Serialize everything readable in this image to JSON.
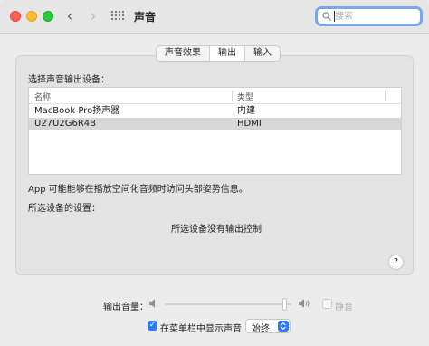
{
  "window": {
    "title": "声音"
  },
  "search": {
    "placeholder": "搜索"
  },
  "tabs": [
    {
      "label": "声音效果"
    },
    {
      "label": "输出",
      "active": true
    },
    {
      "label": "输入"
    }
  ],
  "output": {
    "select_label": "选择声音输出设备：",
    "columns": {
      "name": "名称",
      "type": "类型"
    },
    "devices": [
      {
        "name": "MacBook Pro扬声器",
        "type": "内建"
      },
      {
        "name": "U27U2G6R4B",
        "type": "HDMI",
        "selected": true
      }
    ],
    "note": "App 可能能够在播放空间化音频时访问头部姿势信息。",
    "settings_label": "所选设备的设置：",
    "no_control": "所选设备没有输出控制",
    "help": "?"
  },
  "volume": {
    "label": "输出音量：",
    "level": 0.96,
    "mute_label": "静音",
    "muted": false
  },
  "menubar": {
    "label": "在菜单栏中显示声音",
    "checked": true,
    "popup_value": "始终"
  },
  "colors": {
    "accent": "#2f7bf6",
    "focus_ring": "#7aa7e9"
  }
}
